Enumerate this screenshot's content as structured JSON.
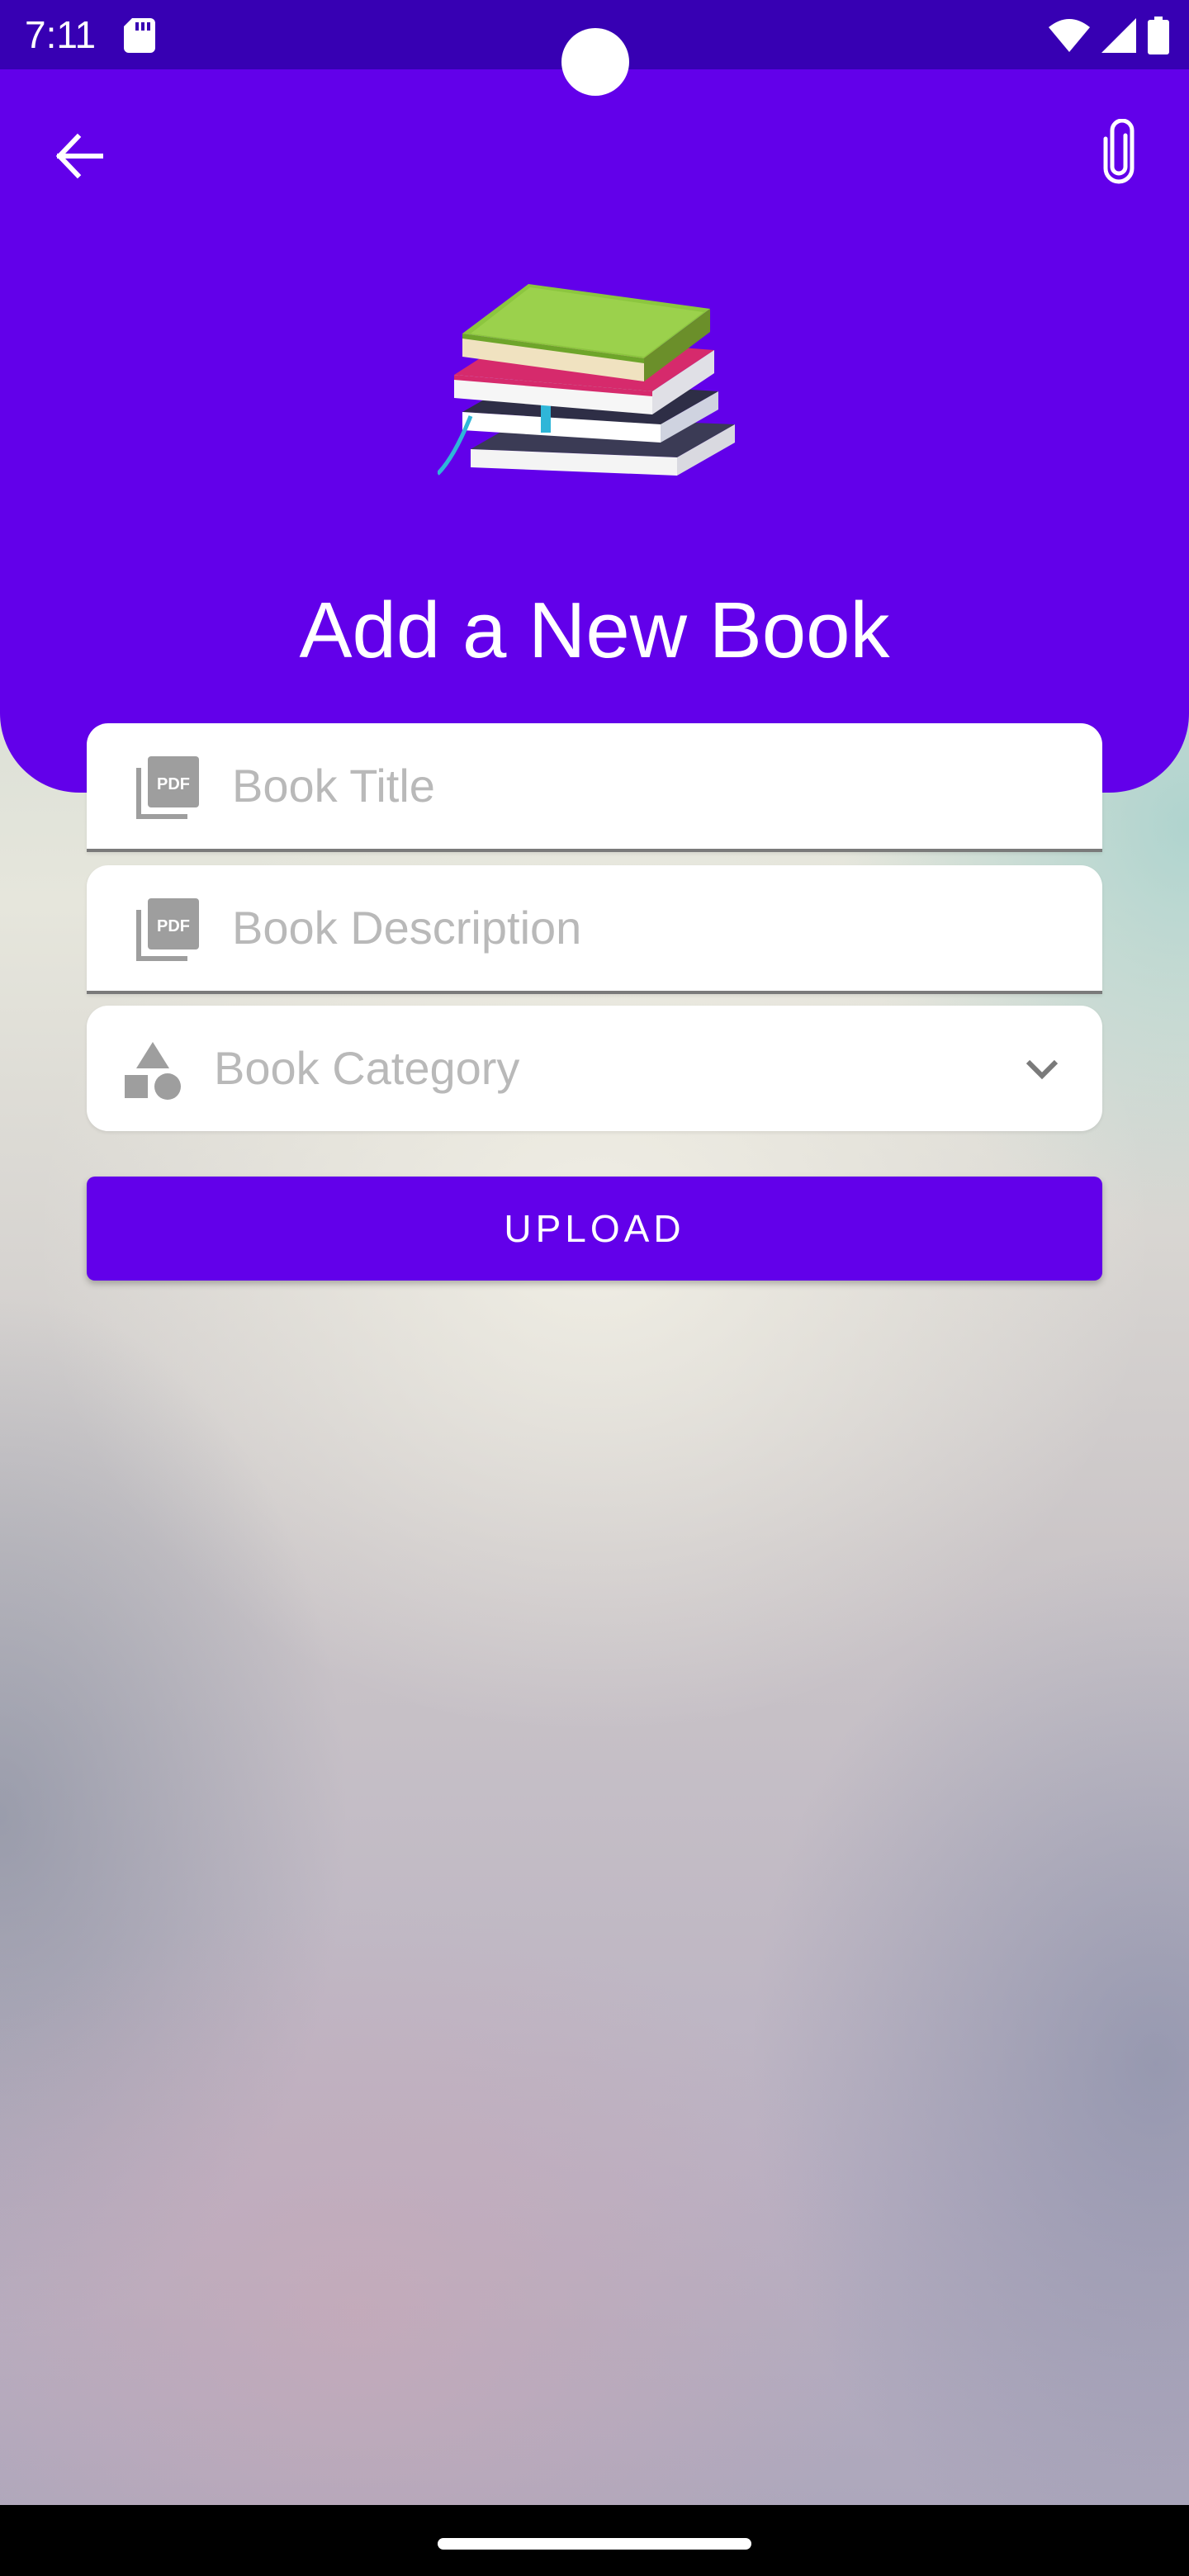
{
  "status_bar": {
    "time": "7:11",
    "icons": [
      "sd-card-icon",
      "wifi-icon",
      "cellular-signal-icon",
      "battery-icon"
    ]
  },
  "header": {
    "title": "Add a New Book",
    "back_icon": "arrow-left-icon",
    "attach_icon": "paperclip-icon",
    "illustration": "books-stack-icon",
    "color": "#6200ea"
  },
  "form": {
    "title_placeholder": "Book Title",
    "description_placeholder": "Book Description",
    "category_placeholder": "Book Category",
    "field_icon": "pdf-icon",
    "category_icon": "shapes-icon",
    "dropdown_icon": "chevron-down-icon"
  },
  "actions": {
    "upload_label": "UPLOAD",
    "upload_color": "#6200ea"
  },
  "colors": {
    "status_bar": "#3700b3",
    "header": "#6200ea",
    "placeholder": "#b9b9b9"
  }
}
